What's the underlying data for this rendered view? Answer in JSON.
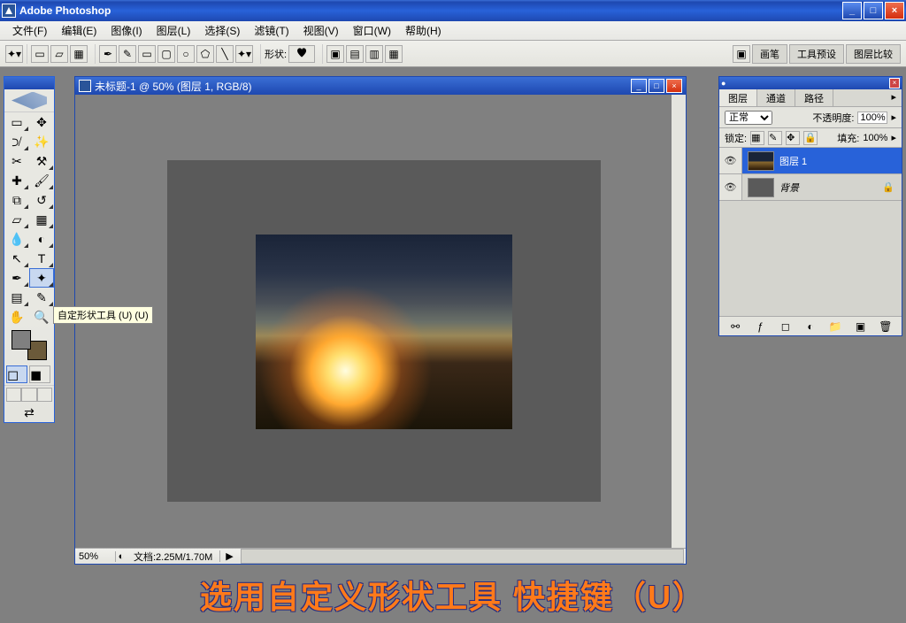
{
  "app": {
    "title": "Adobe Photoshop"
  },
  "menu": {
    "items": [
      "文件(F)",
      "编辑(E)",
      "图像(I)",
      "图层(L)",
      "选择(S)",
      "滤镜(T)",
      "视图(V)",
      "窗口(W)",
      "帮助(H)"
    ]
  },
  "options": {
    "shape_label": "形状:",
    "right_tabs": [
      "画笔",
      "工具预设",
      "图层比较"
    ]
  },
  "doc": {
    "title": "未标题-1 @ 50% (图层 1, RGB/8)",
    "zoom": "50%",
    "info": "文档:2.25M/1.70M"
  },
  "tooltip": "自定形状工具 (U) (U)",
  "layers_panel": {
    "tabs": [
      "图层",
      "通道",
      "路径"
    ],
    "blend_mode": "正常",
    "opacity_label": "不透明度:",
    "opacity_value": "100%",
    "lock_label": "锁定:",
    "fill_label": "填充:",
    "fill_value": "100%",
    "layers": [
      {
        "name": "图层 1",
        "selected": true,
        "bg": false
      },
      {
        "name": "背景",
        "selected": false,
        "bg": true
      }
    ]
  },
  "caption": "选用自定义形状工具  快捷键（U）"
}
